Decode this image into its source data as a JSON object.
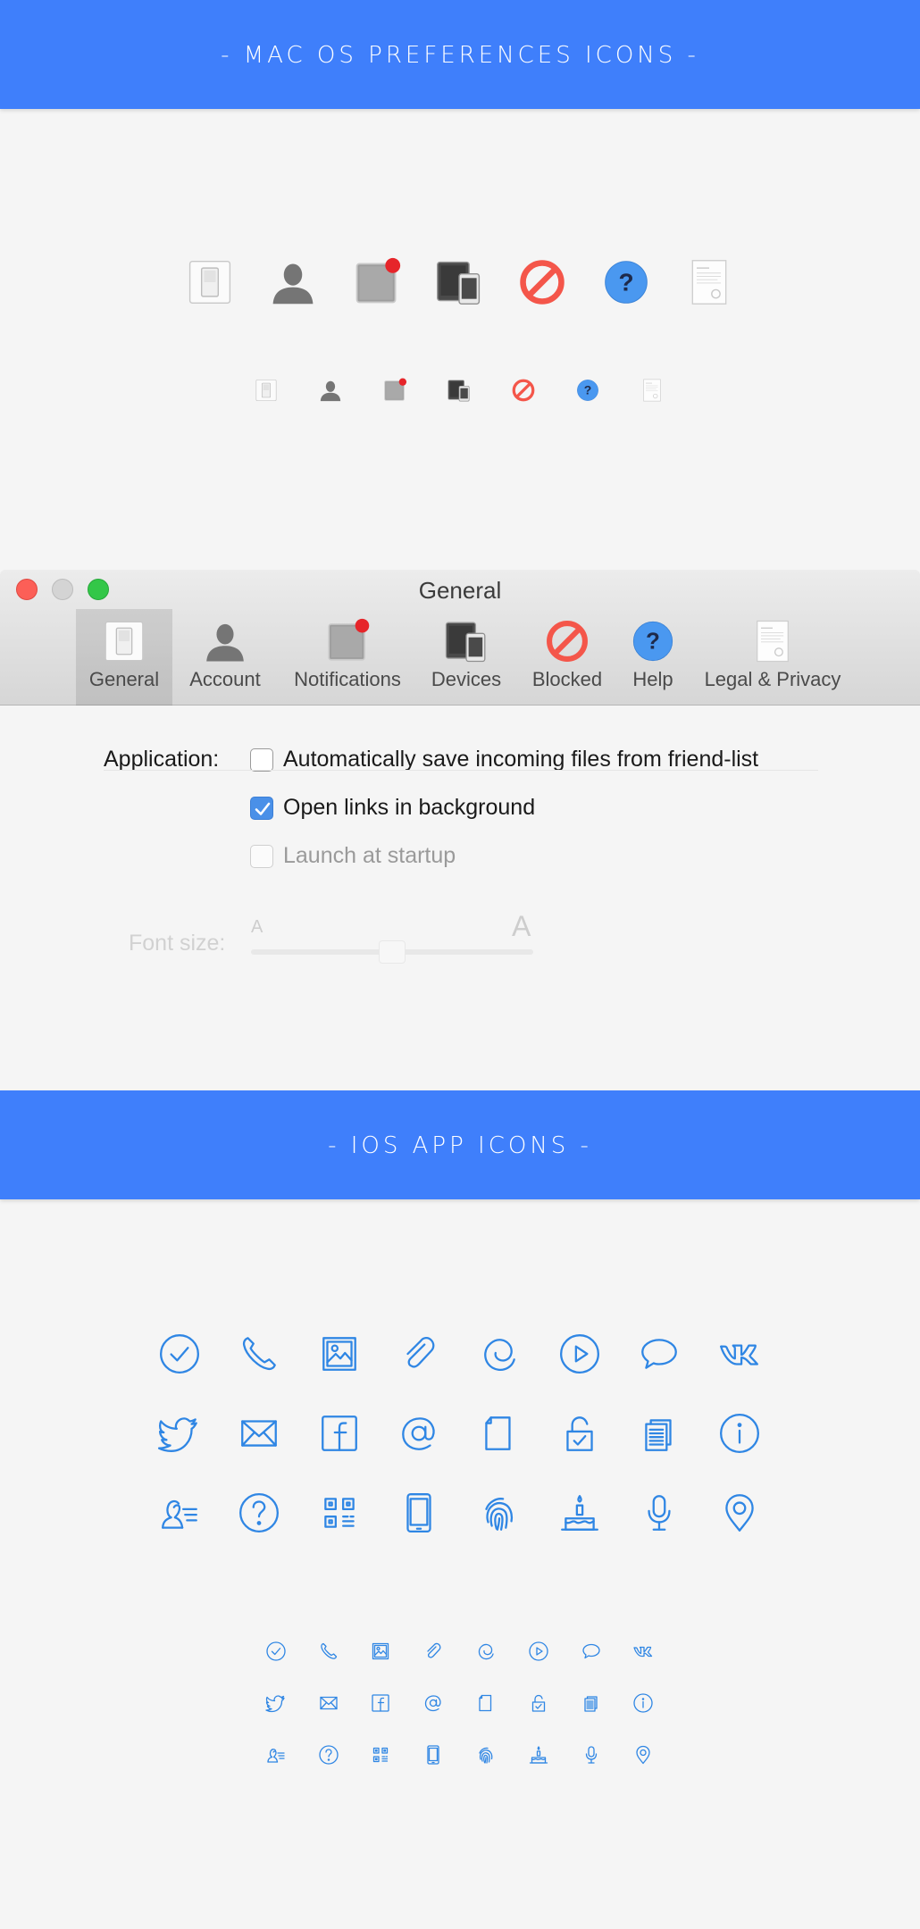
{
  "banners": {
    "mac": "- MAC OS PREFERENCES ICONS -",
    "ios": "- IOS APP ICONS -"
  },
  "mac_icons": [
    "general-switch-icon",
    "account-user-icon",
    "notifications-badge-icon",
    "devices-icon",
    "blocked-icon",
    "help-icon",
    "legal-privacy-document-icon"
  ],
  "window": {
    "title": "General",
    "toolbar": [
      {
        "label": "General",
        "icon": "general-switch-icon",
        "active": true
      },
      {
        "label": "Account",
        "icon": "account-user-icon"
      },
      {
        "label": "Notifications",
        "icon": "notifications-badge-icon"
      },
      {
        "label": "Devices",
        "icon": "devices-icon"
      },
      {
        "label": "Blocked",
        "icon": "blocked-icon"
      },
      {
        "label": "Help",
        "icon": "help-icon"
      },
      {
        "label": "Legal & Privacy",
        "icon": "legal-privacy-document-icon"
      }
    ],
    "settings": {
      "application_label": "Application:",
      "options": [
        {
          "label": "Automatically save incoming files from friend-list",
          "checked": false,
          "disabled": false
        },
        {
          "label": "Open links in background",
          "checked": true,
          "disabled": false
        },
        {
          "label": "Launch at startup",
          "checked": false,
          "disabled": true
        }
      ],
      "font_size_label": "Font size:",
      "font_small": "A",
      "font_large": "A"
    }
  },
  "ios_icons": [
    [
      "checkmark-circle-icon",
      "phone-icon",
      "image-icon",
      "paperclip-icon",
      "spiral-icon",
      "play-circle-icon",
      "chat-bubble-icon",
      "vk-icon"
    ],
    [
      "twitter-icon",
      "mail-icon",
      "facebook-icon",
      "at-sign-icon",
      "document-icon",
      "lock-check-icon",
      "documents-icon",
      "info-circle-icon"
    ],
    [
      "contact-list-icon",
      "question-circle-icon",
      "qr-code-icon",
      "smartphone-icon",
      "fingerprint-icon",
      "birthday-cake-icon",
      "microphone-icon",
      "location-pin-icon"
    ]
  ],
  "colors": {
    "banner": "#3f7ffb",
    "ios_icon": "#2f86e4",
    "red_badge": "#e6252a",
    "blocked": "#f4564a",
    "help": "#4a98f0"
  }
}
